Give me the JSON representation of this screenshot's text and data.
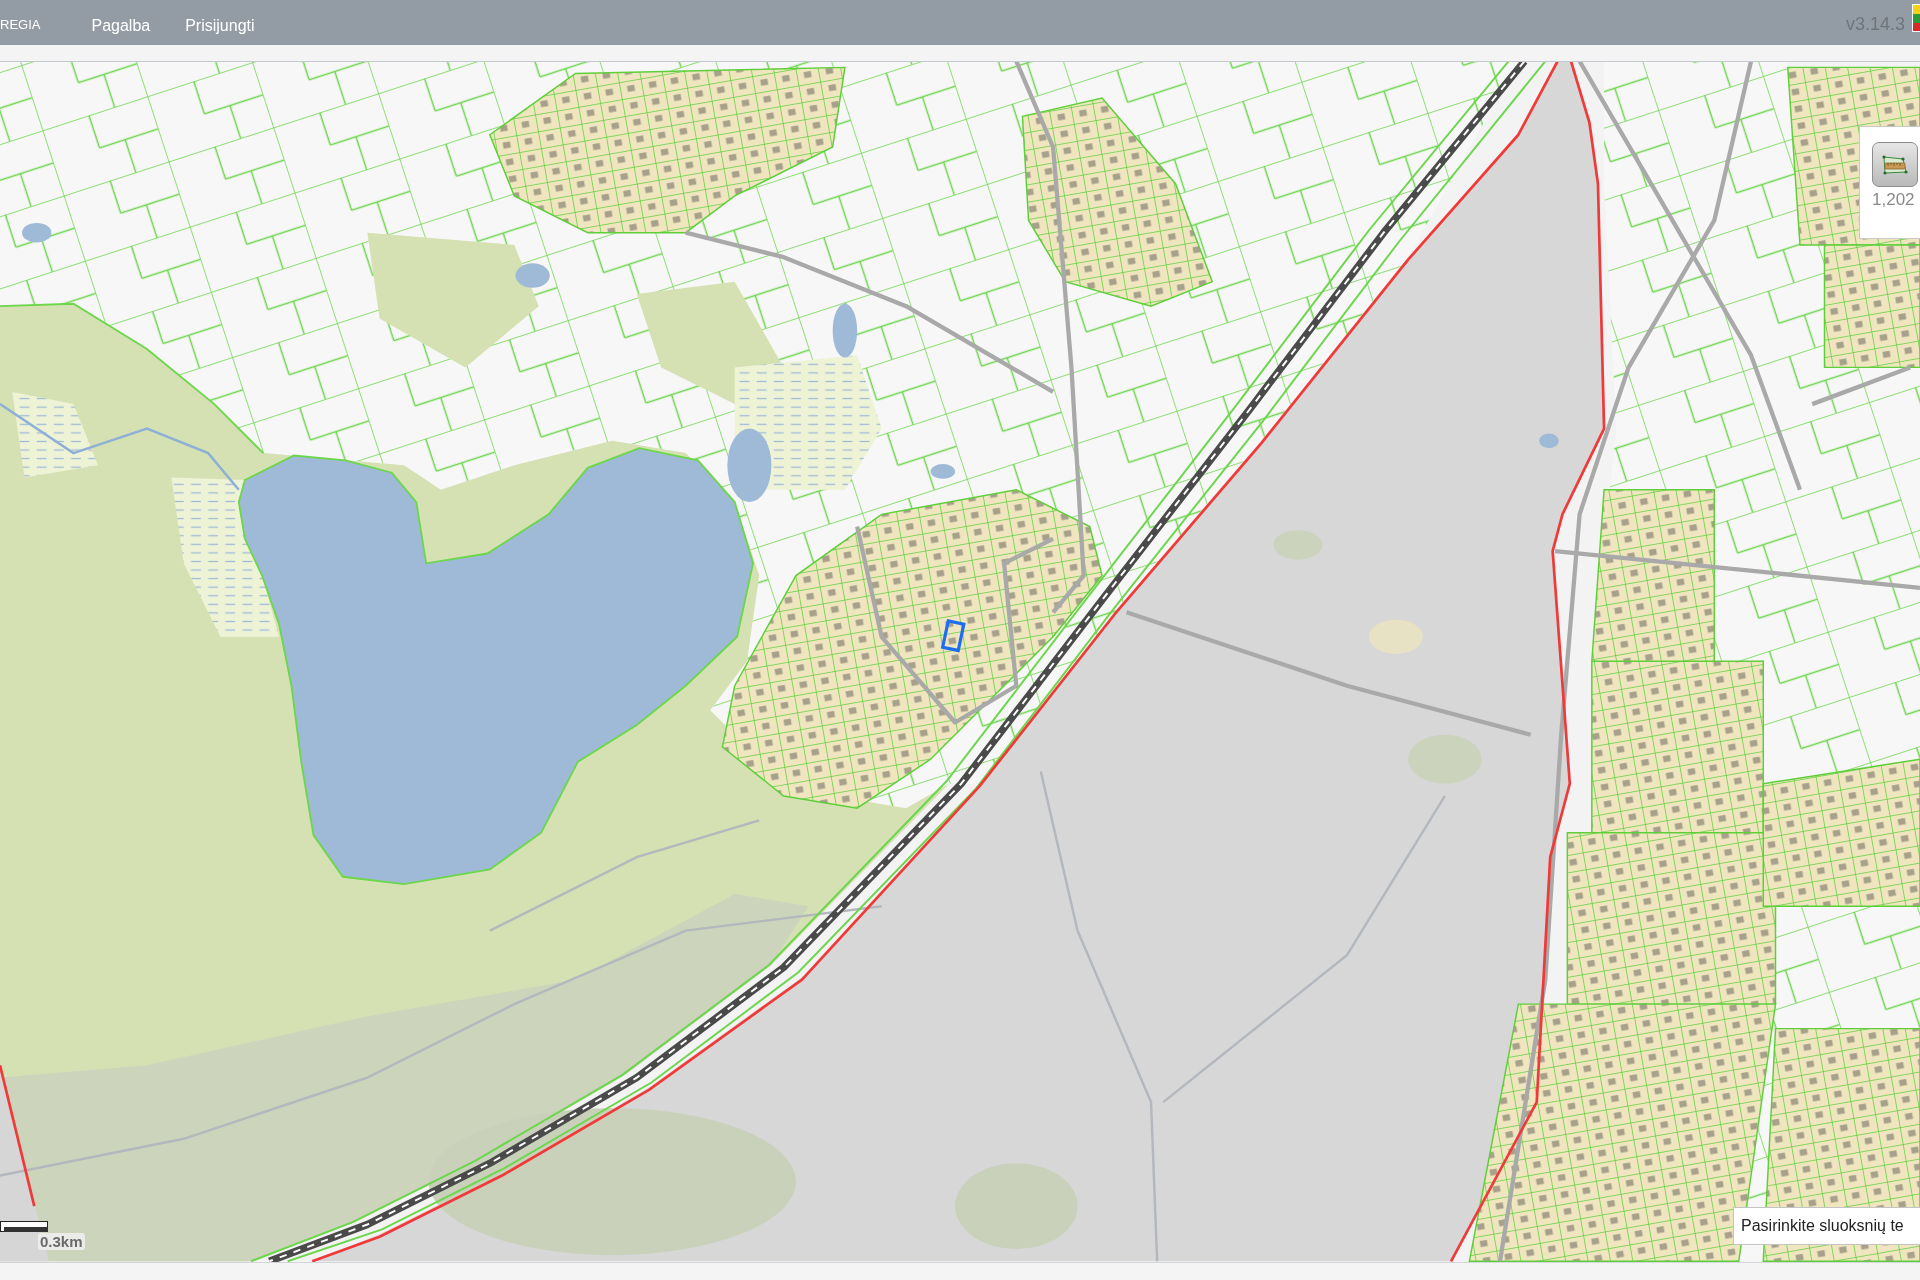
{
  "top_bar": {
    "brand": "REGIA",
    "menu": [
      {
        "label": "Pagalba"
      },
      {
        "label": "Prisijungti"
      }
    ],
    "version": "v3.14.3"
  },
  "map": {
    "scale": {
      "label": "0.3km"
    },
    "measure_panel": {
      "reading": "1,202"
    },
    "layer_search": {
      "placeholder": "Pasirinkite sluoksnių te"
    }
  }
}
